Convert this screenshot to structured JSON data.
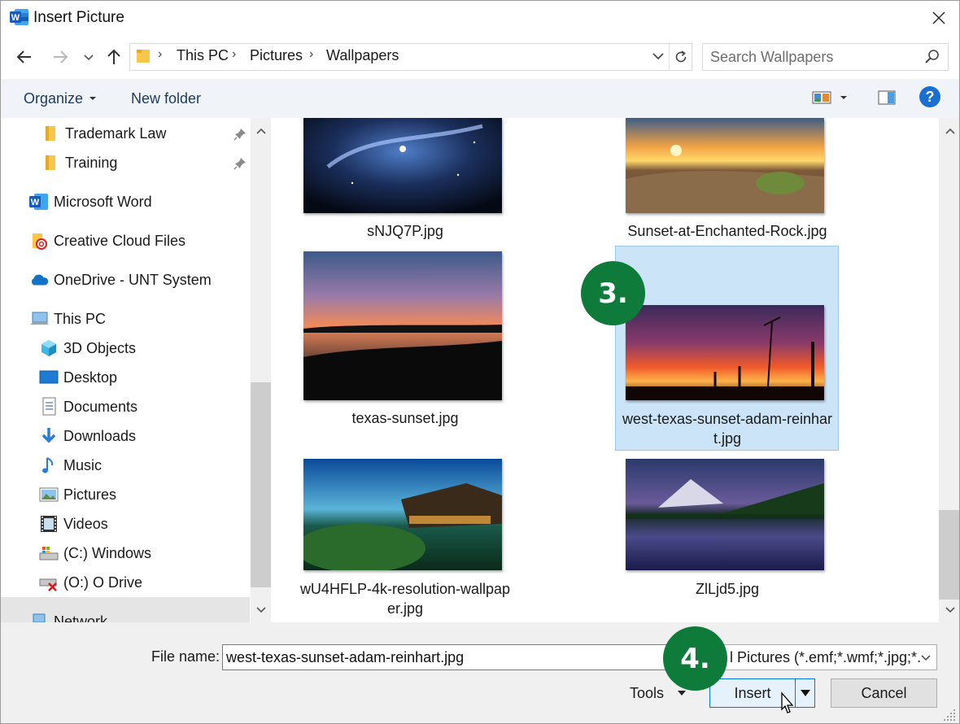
{
  "window": {
    "title": "Insert Picture",
    "app_icon": "word-icon",
    "close_icon": "close-icon"
  },
  "nav": {
    "breadcrumb": [
      "This PC",
      "Pictures",
      "Wallpapers"
    ],
    "search_placeholder": "Search Wallpapers"
  },
  "toolbar": {
    "organize_label": "Organize",
    "new_folder_label": "New folder",
    "help_label": "?"
  },
  "sidebar": {
    "items": [
      {
        "label": "Trademark Law",
        "icon": "folder-icon",
        "pinned": true
      },
      {
        "label": "Training",
        "icon": "folder-icon",
        "pinned": true
      },
      {
        "label": "Microsoft Word",
        "icon": "word-icon"
      },
      {
        "label": "Creative Cloud Files",
        "icon": "creative-cloud-icon"
      },
      {
        "label": "OneDrive - UNT System",
        "icon": "onedrive-icon"
      },
      {
        "label": "This PC",
        "icon": "computer-icon"
      },
      {
        "label": "3D Objects",
        "icon": "3d-objects-icon"
      },
      {
        "label": "Desktop",
        "icon": "desktop-icon"
      },
      {
        "label": "Documents",
        "icon": "documents-icon"
      },
      {
        "label": "Downloads",
        "icon": "downloads-icon"
      },
      {
        "label": "Music",
        "icon": "music-icon"
      },
      {
        "label": "Pictures",
        "icon": "pictures-icon",
        "selected": true
      },
      {
        "label": "Videos",
        "icon": "videos-icon"
      },
      {
        "label": "(C:) Windows",
        "icon": "drive-c-icon"
      },
      {
        "label": "(O:) O Drive",
        "icon": "network-drive-icon"
      },
      {
        "label": "Network",
        "icon": "network-icon"
      }
    ]
  },
  "files": [
    {
      "name": "sNJQ7P.jpg"
    },
    {
      "name": "Sunset-at-Enchanted-Rock.jpg"
    },
    {
      "name": "texas-sunset.jpg"
    },
    {
      "name_line1": "west-texas-sunset-adam-reinhar",
      "name_line2": "t.jpg",
      "selected": true
    },
    {
      "name_line1": "wU4HFLP-4k-resolution-wallpap",
      "name_line2": "er.jpg"
    },
    {
      "name": "ZlLjd5.jpg"
    }
  ],
  "callouts": {
    "step3": "3.",
    "step4": "4."
  },
  "bottom": {
    "file_name_label": "File name:",
    "file_name_value": "west-texas-sunset-adam-reinhart.jpg",
    "filter_value": "l Pictures (*.emf;*.wmf;*.jpg;*.",
    "tools_label": "Tools",
    "insert_label": "Insert",
    "cancel_label": "Cancel"
  },
  "colors": {
    "toolbar_bg": "#f0f4f9",
    "selection": "#cce4f7",
    "callout": "#0f7b3a",
    "accent": "#0078d7"
  }
}
